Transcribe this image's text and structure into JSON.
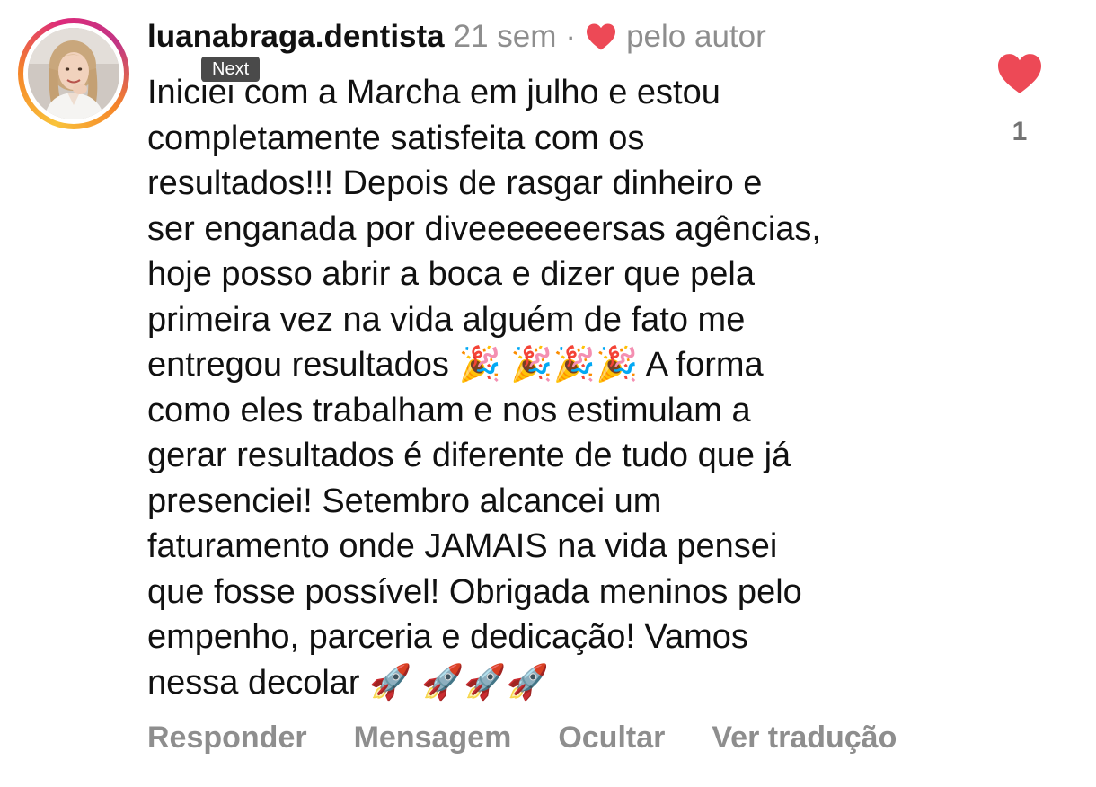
{
  "comment": {
    "username": "luanabraga.dentista",
    "time": "21 sem",
    "separator": "·",
    "liked_by_author_label": "pelo autor",
    "text": "Iniciei com a Marcha em julho e estou\ncompletamente satisfeita com os\nresultados!!! Depois de rasgar dinheiro e\nser enganada por diveeeeeeersas agências,\nhoje posso abrir a boca e dizer que pela\nprimeira vez na vida alguém de fato me\nentregou resultados 🎉 🎉🎉🎉 A forma\ncomo eles trabalham e nos estimulam a\ngerar resultados é diferente de tudo que já\npresenciei! Setembro alcancei um\nfaturamento onde JAMAIS na vida pensei\nque fosse possível! Obrigada meninos pelo\nempenho, parceria e dedicação! Vamos\nnessa decolar 🚀 🚀🚀🚀",
    "like_count": "1"
  },
  "tooltip": {
    "label": "Next"
  },
  "actions": {
    "reply": "Responder",
    "message": "Mensagem",
    "hide": "Ocultar",
    "translate": "Ver tradução"
  },
  "icons": {
    "heart": "heart-icon",
    "avatar": "profile-photo"
  },
  "colors": {
    "heart_red": "#ed4956",
    "muted_text": "#8e8e8e",
    "text": "#111111",
    "story_ring": [
      "#f9c33b",
      "#f58529",
      "#dd2a7b",
      "#c13584"
    ]
  }
}
